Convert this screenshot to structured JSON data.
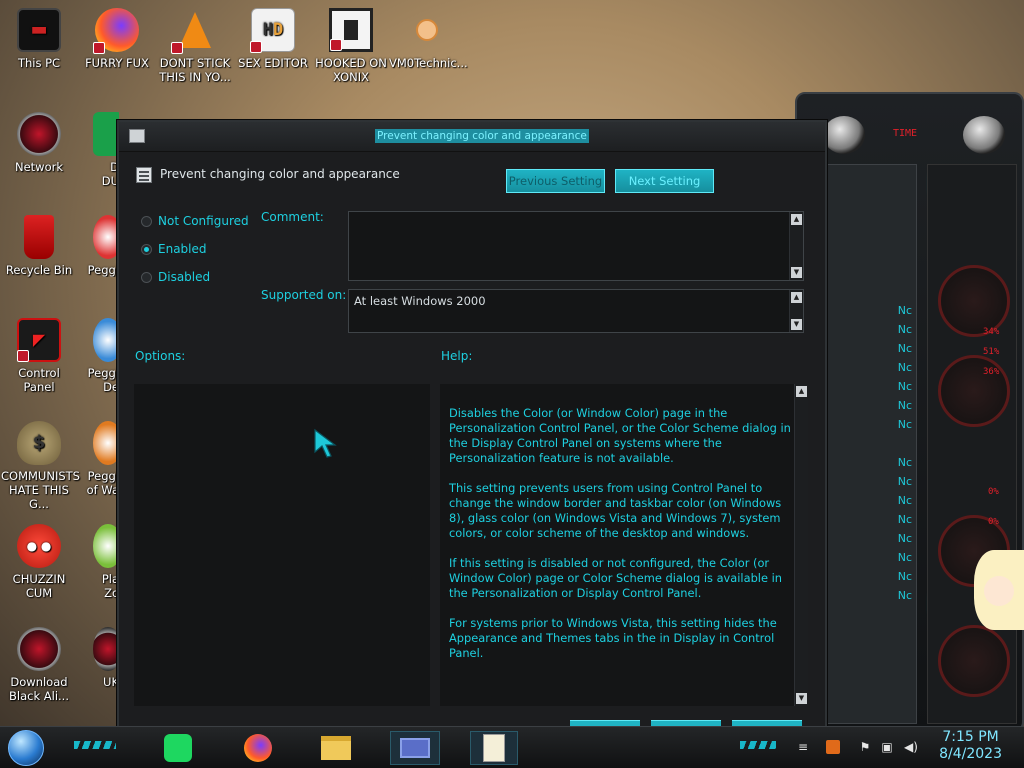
{
  "desktop_icons": [
    {
      "label": "This PC",
      "icon": "computer-icon"
    },
    {
      "label": "FURRY FUX",
      "icon": "firefox-icon"
    },
    {
      "label": "DONT STICK\nTHIS IN YO...",
      "icon": "vlc-cone-icon"
    },
    {
      "label": "SEX EDITOR",
      "icon": "hxd-editor-icon"
    },
    {
      "label": "HOOKED ON\nXONIX",
      "icon": "xonix-game-icon"
    },
    {
      "label": "VM0Technic...",
      "icon": "doctor-icon"
    },
    {
      "label": "Network",
      "icon": "alien-network-icon"
    },
    {
      "label": "Recycle Bin",
      "icon": "recycle-bin-icon"
    },
    {
      "label": "Control Panel",
      "icon": "control-panel-icon"
    },
    {
      "label": "COMMUNISTS\nHATE THIS G...",
      "icon": "money-bag-icon"
    },
    {
      "label": "CHUZZIN\nCUM",
      "icon": "chuzzle-icon"
    },
    {
      "label": "Download\nBlack Ali...",
      "icon": "alien-download-icon"
    },
    {
      "label": "D\nDU",
      "icon": "partial-icon"
    },
    {
      "label": "Peggl",
      "icon": "peggle-icon"
    },
    {
      "label": "Peggl\nDe",
      "icon": "peggle-icon"
    },
    {
      "label": "Peggl\nof Wa",
      "icon": "peggle-icon"
    },
    {
      "label": "Pla\nZo",
      "icon": "plants-icon"
    },
    {
      "label": "UK",
      "icon": "partial-icon"
    }
  ],
  "dialog": {
    "window_title": "Prevent changing color and appearance",
    "policy_title": "Prevent changing color and appearance",
    "buttons": {
      "previous": "Previous Setting",
      "next": "Next Setting"
    },
    "options": {
      "not_configured": "Not Configured",
      "enabled": "Enabled",
      "disabled": "Disabled",
      "selected": "Enabled"
    },
    "comment_label": "Comment:",
    "comment_value": "",
    "supported_label": "Supported on:",
    "supported_value": "At least Windows 2000",
    "options_label": "Options:",
    "help_label": "Help:",
    "help_paragraphs": [
      "Disables the Color (or Window Color) page in the Personalization Control Panel, or the Color Scheme dialog in the Display Control Panel on systems where the Personalization feature is not available.",
      "This setting prevents users from using Control Panel to change the window border and taskbar color (on Windows 8), glass color (on Windows Vista and Windows 7), system colors, or color scheme of the desktop and windows.",
      "If this setting is disabled or not configured, the Color (or Window Color) page or Color Scheme dialog is available in the Personalization or Display Control Panel.",
      "For systems prior to Windows Vista, this setting hides the Appearance and Themes tabs in the in Display in Control Panel."
    ]
  },
  "gadget": {
    "readouts": [
      "34%",
      "51%",
      "36%",
      "0%",
      "0%"
    ],
    "list_items": [
      "Nc",
      "Nc",
      "Nc",
      "Nc",
      "Nc",
      "Nc",
      "Nc",
      "Nc",
      "Nc",
      "Nc",
      "Nc",
      "Nc",
      "Nc",
      "Nc",
      "Nc"
    ]
  },
  "taskbar": {
    "apps": [
      "spotify-icon",
      "firefox-icon",
      "file-explorer-icon",
      "control-panel-icon",
      "notepad-icon"
    ],
    "tray": [
      "keyboard-icon",
      "pdf-icon",
      "flag-icon",
      "network-icon",
      "volume-icon"
    ],
    "time": "7:15 PM",
    "date": "8/4/2023"
  },
  "colors": {
    "accent": "#1ed0e0",
    "button": "#1fb3c4",
    "dialog_bg": "#1c1d1f",
    "gadget_red": "#e0202a"
  }
}
